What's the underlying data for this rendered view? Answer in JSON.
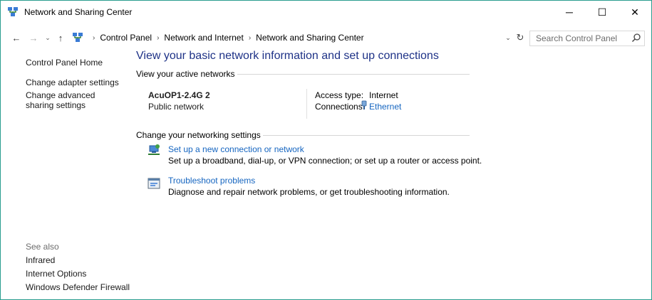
{
  "window": {
    "title": "Network and Sharing Center",
    "controls": {
      "minimize": "─",
      "maximize": "☐",
      "close": "✕"
    }
  },
  "address": {
    "crumbs": [
      "Control Panel",
      "Network and Internet",
      "Network and Sharing Center"
    ],
    "search_placeholder": "Search Control Panel"
  },
  "leftnav": {
    "home": "Control Panel Home",
    "adapter": "Change adapter settings",
    "sharing": "Change advanced sharing settings"
  },
  "seealso": {
    "label": "See also",
    "items": [
      "Infrared",
      "Internet Options",
      "Windows Defender Firewall"
    ]
  },
  "main": {
    "heading": "View your basic network information and set up connections",
    "active_networks": {
      "title": "View your active networks",
      "network_name": "AcuOP1-2.4G 2",
      "network_type": "Public network",
      "access_label": "Access type:",
      "access_value": "Internet",
      "connections_label": "Connections:",
      "connections_value": "Ethernet"
    },
    "settings": {
      "title": "Change your networking settings",
      "tasks": [
        {
          "link": "Set up a new connection or network",
          "desc": "Set up a broadband, dial-up, or VPN connection; or set up a router or access point."
        },
        {
          "link": "Troubleshoot problems",
          "desc": "Diagnose and repair network problems, or get troubleshooting information."
        }
      ]
    }
  },
  "colors": {
    "accent_border": "#2a9d8f",
    "heading": "#1e3287",
    "link": "#1565c0"
  }
}
